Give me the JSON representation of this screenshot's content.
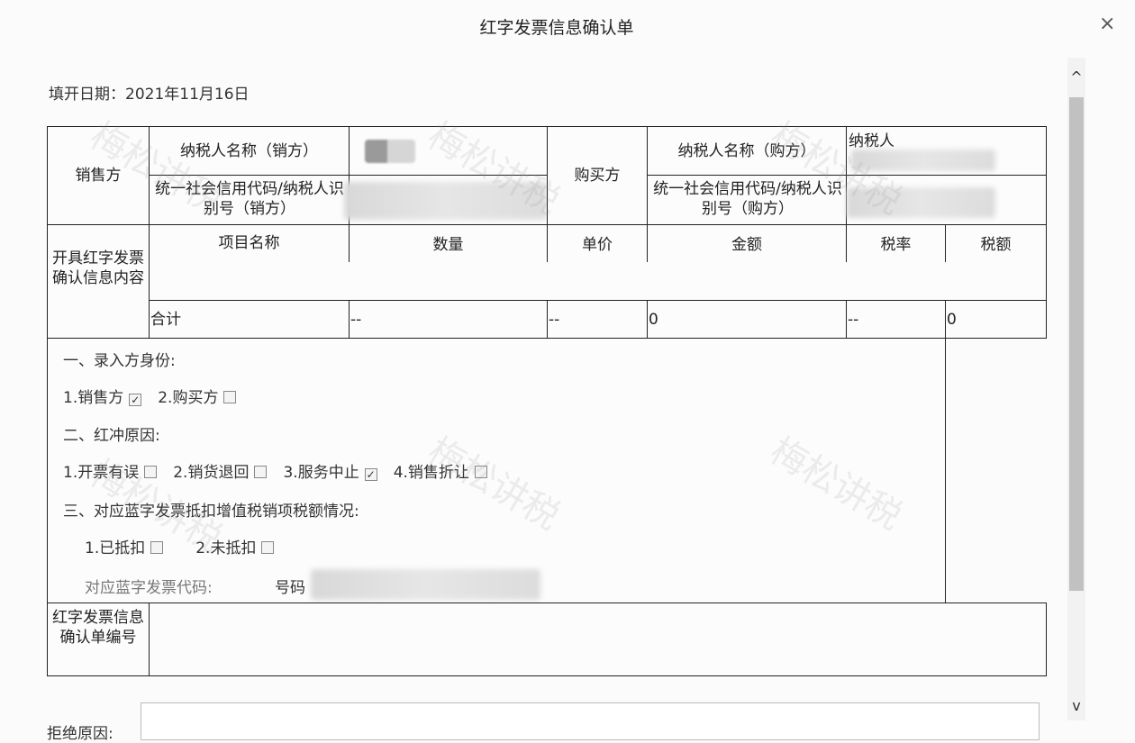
{
  "dialog": {
    "title": "红字发票信息确认单",
    "close_label": "×",
    "date_label": "填开日期：2021年11月16日"
  },
  "seller": {
    "section_label": "销售方",
    "name_label": "纳税人名称（销方）",
    "id_label": "统一社会信用代码/纳税人识别号（销方）"
  },
  "buyer": {
    "section_label": "购买方",
    "name_label": "纳税人名称（购方）",
    "name_value_prefix": "纳税人",
    "id_label": "统一社会信用代码/纳税人识别号（购方）"
  },
  "items": {
    "section_label": "开具红字发票确认信息内容",
    "headers": [
      "项目名称",
      "数量",
      "单价",
      "金额",
      "税率",
      "税额"
    ],
    "total_row": [
      "合计",
      "--",
      "--",
      "0",
      "--",
      "0"
    ]
  },
  "options": {
    "role_title": "一、录入方身份:",
    "role_options": [
      {
        "label": "1.销售方",
        "checked": true
      },
      {
        "label": "2.购买方",
        "checked": false
      }
    ],
    "reason_title": "二、红冲原因:",
    "reason_options": [
      {
        "label": "1.开票有误",
        "checked": false
      },
      {
        "label": "2.销货退回",
        "checked": false
      },
      {
        "label": "3.服务中止",
        "checked": true
      },
      {
        "label": "4.销售折让",
        "checked": false
      }
    ],
    "deduct_title": "三、对应蓝字发票抵扣增值税销项税额情况:",
    "deduct_options": [
      {
        "label": "1.已抵扣",
        "checked": false
      },
      {
        "label": "2.未抵扣",
        "checked": false
      }
    ],
    "blue_code_label": "对应蓝字发票代码:",
    "blue_number_label": "号码"
  },
  "confirm_no": {
    "label": "红字发票信息确认单编号"
  },
  "reject": {
    "label": "拒绝原因:"
  },
  "watermark": "梅松讲税",
  "scroll": {
    "up_arrow": "^",
    "down_arrow": "v"
  }
}
